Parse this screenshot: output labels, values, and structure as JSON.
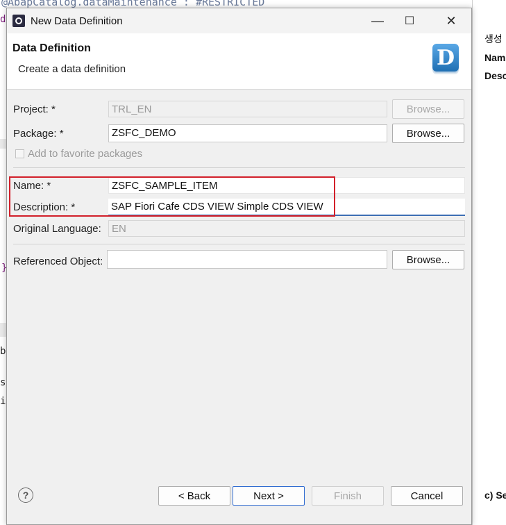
{
  "background": {
    "editor_code_line": "@AbapCatalog.dataMaintenance : #RESTRICTED",
    "right_panel": {
      "line1": "생성",
      "line2": "Nam",
      "line3": "Desc",
      "bottom_text": "c)  Se"
    }
  },
  "window": {
    "title": "New Data Definition",
    "minimize_symbol": "—",
    "maximize_symbol": "☐",
    "close_symbol": "✕"
  },
  "header": {
    "title": "Data Definition",
    "subtitle": "Create a data definition",
    "icon_letter": "D"
  },
  "form": {
    "project": {
      "label": "Project: *",
      "value": "TRL_EN",
      "browse": "Browse..."
    },
    "package": {
      "label": "Package: *",
      "value": "ZSFC_DEMO",
      "browse": "Browse..."
    },
    "favorite": {
      "label": "Add to favorite packages",
      "checked": false
    },
    "name": {
      "label": "Name: *",
      "value": "ZSFC_SAMPLE_ITEM"
    },
    "description": {
      "label": "Description: *",
      "value": "SAP Fiori Cafe CDS VIEW Simple CDS VIEW"
    },
    "original_language": {
      "label": "Original Language:",
      "value": "EN"
    },
    "referenced_object": {
      "label": "Referenced Object:",
      "value": "",
      "browse": "Browse..."
    }
  },
  "footer": {
    "help": "?",
    "back": "< Back",
    "next": "Next >",
    "finish": "Finish",
    "cancel": "Cancel"
  },
  "colors": {
    "highlight_border": "#d21f2a",
    "active_underline": "#3d6fb4",
    "primary_button_border": "#2f6bd0"
  }
}
